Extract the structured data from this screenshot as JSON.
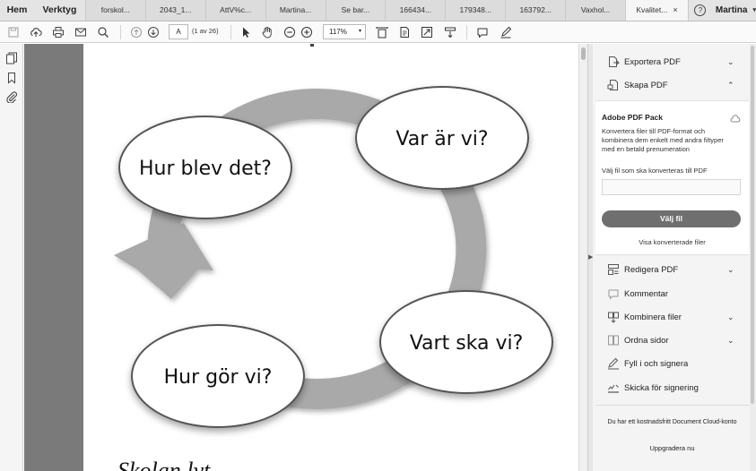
{
  "tabbar": {
    "home": "Hem",
    "tools": "Verktyg",
    "doc_tabs": [
      "forskol...",
      "2043_1...",
      "AttV%c...",
      "Martina...",
      "Se bar...",
      "166434...",
      "179348...",
      "163792...",
      "Vaxhol...",
      "Kvalitet..."
    ],
    "active_tab_close": "×",
    "help": "?",
    "user": "Martina",
    "user_caret": "▾"
  },
  "toolbar": {
    "page_value": "A",
    "page_count": "(1 av 26)",
    "zoom_value": "117%",
    "zoom_caret": "▾"
  },
  "document": {
    "bubbles": [
      "Hur blev det?",
      "Var är vi?",
      "Vart ska vi?",
      "Hur gör vi?"
    ],
    "bottom_text": "Skolan lyt"
  },
  "right_pane": {
    "export_pdf": "Exportera PDF",
    "create_pdf": "Skapa PDF",
    "card_title": "Adobe PDF Pack",
    "card_desc": "Konvertera filer till PDF-format och kombinera dem enkelt med andra filtyper med en betald prenumeration",
    "file_label": "Välj fil som ska konverteras till PDF",
    "choose_file": "Välj fil",
    "show_converted": "Visa konverterade filer",
    "tools": [
      "Redigera PDF",
      "Kommentar",
      "Kombinera filer",
      "Ordna sidor",
      "Fyll i och signera",
      "Skicka för signering"
    ],
    "promo": "Du har ett kostnadsfritt Document Cloud-konto",
    "upgrade": "Uppgradera nu"
  },
  "colors": {
    "arrow_gray": "#a9a9a9",
    "bubble_fill": "#ffffff",
    "button_gray": "#6f6f6f",
    "doc_background": "#7a7a7a"
  }
}
